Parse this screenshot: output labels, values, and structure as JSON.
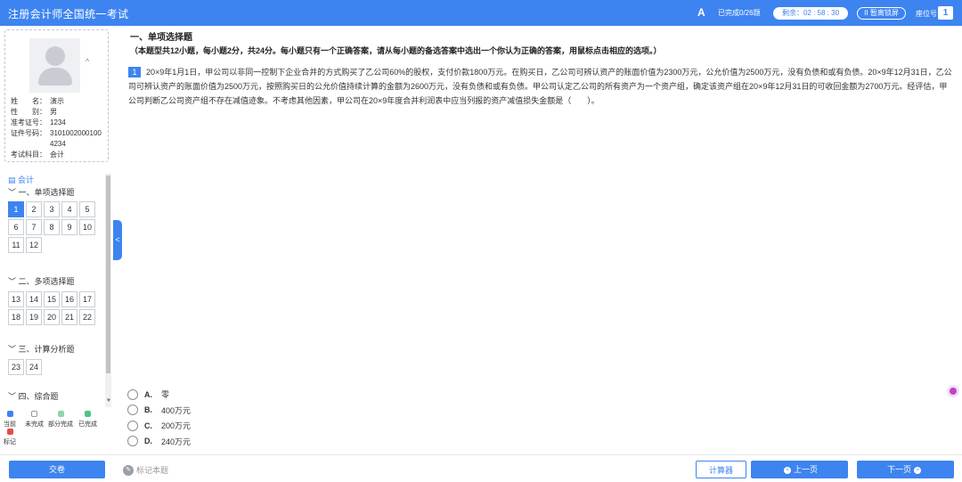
{
  "header": {
    "title": "注册会计师全国统一考试",
    "font_icon": "A",
    "progress": "已完成0/26题",
    "timer": "剩余：02 : 58 : 30",
    "pause_label": "II 暂离锁屏",
    "seat_label": "座位号",
    "seat_number": "1"
  },
  "candidate": {
    "rows": [
      {
        "k": "姓　　名：",
        "v": "演示"
      },
      {
        "k": "性　　别：",
        "v": "男"
      },
      {
        "k": "准考证号：",
        "v": "1234"
      },
      {
        "k": "证件号码：",
        "v": "31010020001004234"
      },
      {
        "k": "考试科目：",
        "v": "会计"
      }
    ]
  },
  "nav": {
    "subject": "会计",
    "sections": [
      {
        "label": "﹀ 一、单项选择题",
        "questions": [
          "1",
          "2",
          "3",
          "4",
          "5",
          "6",
          "7",
          "8",
          "9",
          "10",
          "11",
          "12"
        ]
      },
      {
        "label": "﹀ 二、多项选择题",
        "questions": [
          "13",
          "14",
          "15",
          "16",
          "17",
          "18",
          "19",
          "20",
          "21",
          "22"
        ]
      },
      {
        "label": "﹀ 三、计算分析题",
        "questions": [
          "23",
          "24"
        ]
      },
      {
        "label": "﹀ 四、综合题",
        "questions": []
      }
    ],
    "current": "1",
    "legend": [
      {
        "label": "当前",
        "color": "#3d84f0"
      },
      {
        "label": "未完成",
        "color": "#ffffff"
      },
      {
        "label": "部分完成",
        "color": "#8fd4b0"
      },
      {
        "label": "已完成",
        "color": "#4cc48a"
      },
      {
        "label": "标记",
        "color": "#e84a4a"
      }
    ]
  },
  "main": {
    "section_title": "一、单项选择题",
    "section_desc": "（本题型共12小题，每小题2分，共24分。每小题只有一个正确答案，请从每小题的备选答案中选出一个你认为正确的答案，用鼠标点击相应的选项。）",
    "question_number": "1",
    "question_text": "20×9年1月1日，甲公司以非同一控制下企业合并的方式购买了乙公司60%的股权，支付价款1800万元。在购买日，乙公司可辨认资产的账面价值为2300万元，公允价值为2500万元，没有负债和或有负债。20×9年12月31日，乙公司可辨认资产的账面价值为2500万元，按照购买日的公允价值持续计算的金额为2600万元，没有负债和或有负债。甲公司认定乙公司的所有资产为一个资产组，确定该资产组在20×9年12月31日的可收回金额为2700万元。经评估，甲公司判断乙公司资产组不存在减值迹象。不考虑其他因素，甲公司在20×9年度合并利润表中应当列报的资产减值损失金额是（　　）。",
    "options": [
      {
        "letter": "A.",
        "text": "零"
      },
      {
        "letter": "B.",
        "text": "400万元"
      },
      {
        "letter": "C.",
        "text": "200万元"
      },
      {
        "letter": "D.",
        "text": "240万元"
      }
    ]
  },
  "footer": {
    "submit": "交卷",
    "mark": "标记本题",
    "calculator": "计算器",
    "prev": "上一页",
    "next": "下一页"
  }
}
